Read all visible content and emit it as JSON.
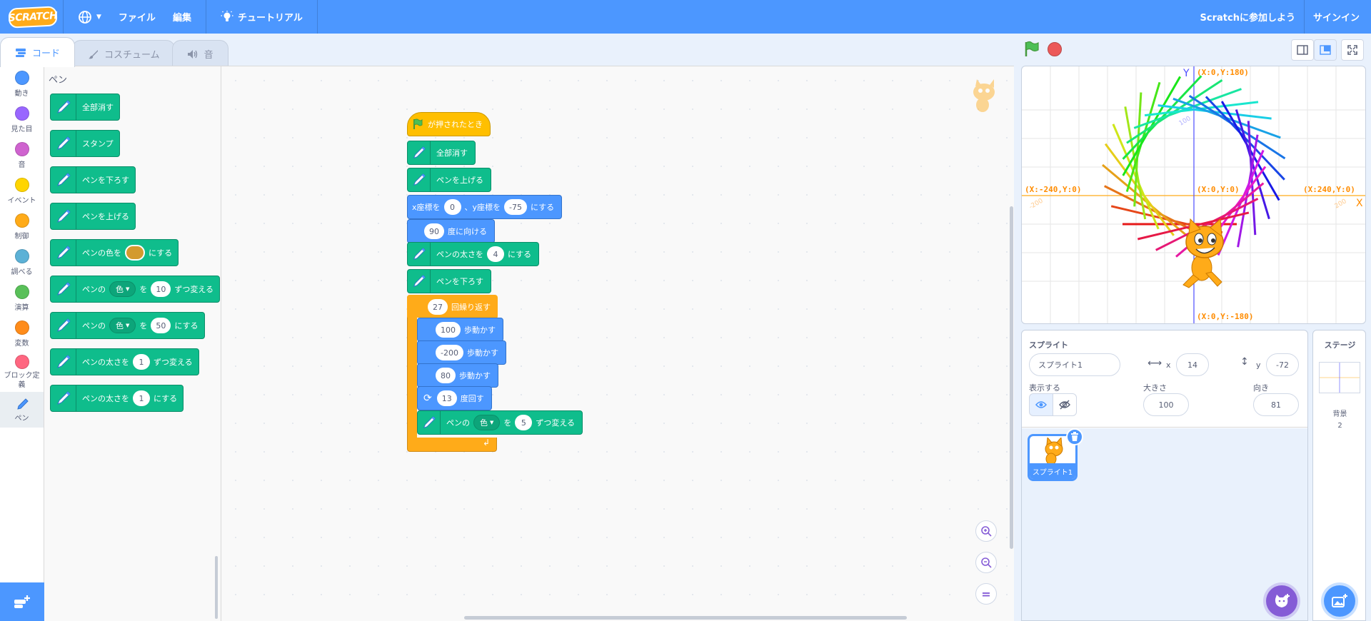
{
  "menubar": {
    "logo": "SCRATCH",
    "file": "ファイル",
    "edit": "編集",
    "tutorials": "チュートリアル",
    "join": "Scratchに参加しよう",
    "signin": "サインイン"
  },
  "tabs": {
    "code": "コード",
    "costumes": "コスチューム",
    "sounds": "音"
  },
  "categories": [
    {
      "label": "動き",
      "color": "#4c97ff"
    },
    {
      "label": "見た目",
      "color": "#9966ff"
    },
    {
      "label": "音",
      "color": "#cf63cf"
    },
    {
      "label": "イベント",
      "color": "#ffd500"
    },
    {
      "label": "制御",
      "color": "#ffab19"
    },
    {
      "label": "調べる",
      "color": "#5cb1d6"
    },
    {
      "label": "演算",
      "color": "#59c059"
    },
    {
      "label": "変数",
      "color": "#ff8c1a"
    },
    {
      "label": "ブロック定義",
      "color": "#ff6680"
    },
    {
      "label": "ペン",
      "color": "#0fbd8c"
    }
  ],
  "palette": {
    "title": "ペン",
    "clear": "全部消す",
    "stamp": "スタンプ",
    "pen_down": "ペンを下ろす",
    "pen_up": "ペンを上げる",
    "set_color_a": "ペンの色を",
    "set_color_b": "にする",
    "change_param_a": "ペンの",
    "param_menu": "色",
    "change_param_b": "を",
    "change_param_val": "10",
    "change_param_c": "ずつ変える",
    "set_param_val": "50",
    "set_param_c": "にする",
    "change_size_a": "ペンの太さを",
    "change_size_val": "1",
    "change_size_b": "ずつ変える",
    "set_size_a": "ペンの太さを",
    "set_size_val": "1",
    "set_size_b": "にする"
  },
  "script": {
    "hat": "が押されたとき",
    "clear": "全部消す",
    "pen_up": "ペンを上げる",
    "goto_x_label": "x座標を",
    "goto_x": "0",
    "goto_sep": "、y座標を",
    "goto_y": "-75",
    "goto_end": "にする",
    "point_dir": "90",
    "point_label": "度に向ける",
    "size_label": "ペンの太さを",
    "size_val": "4",
    "size_end": "にする",
    "pen_down": "ペンを下ろす",
    "repeat_count": "27",
    "repeat_label": "回繰り返す",
    "move1": "100",
    "move2": "-200",
    "move3": "80",
    "move_label": "歩動かす",
    "turn_val": "13",
    "turn_label": "度回す",
    "chg_a": "ペンの",
    "chg_menu": "色",
    "chg_b": "を",
    "chg_val": "5",
    "chg_c": "ずつ変える"
  },
  "stage_labels": {
    "top": "(X:0,Y:180)",
    "bottom": "(X:0,Y:-180)",
    "left": "(X:-240,Y:0)",
    "right": "(X:240,Y:0)",
    "center": "(X:0,Y:0)",
    "axis_y": "Y",
    "axis_x": "X",
    "tick_100": "100",
    "tick_n200": "-200",
    "tick_200": "200"
  },
  "sprite": {
    "section": "スプライト",
    "name": "スプライト1",
    "x_label": "x",
    "x": "14",
    "y_label": "y",
    "y": "-72",
    "show_label": "表示する",
    "size_label": "大きさ",
    "size": "100",
    "dir_label": "向き",
    "direction": "81",
    "thumb_name": "スプライト1"
  },
  "stage_pane": {
    "title": "ステージ",
    "backdrops_label": "背景",
    "backdrops_count": "2"
  },
  "colors": {
    "menubar": "#4c97ff",
    "pen": "#0fbd8c",
    "motion": "#4c97ff",
    "events": "#ffbf00",
    "control": "#ffab19"
  }
}
